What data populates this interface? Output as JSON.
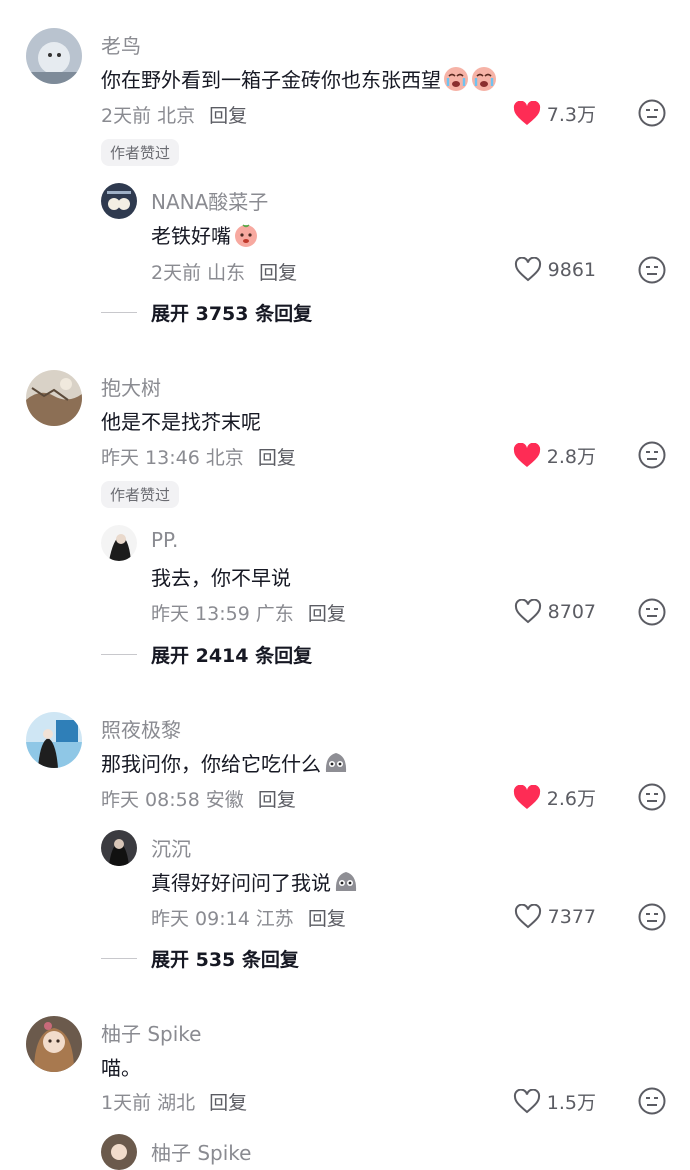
{
  "threads": [
    {
      "user": "老鸟",
      "text": "你在野外看到一箱子金砖你也东张西望",
      "emoji": [
        "crying-face",
        "crying-face"
      ],
      "time": "2天前",
      "location": "北京",
      "reply_label": "回复",
      "likes": "7.3万",
      "liked": true,
      "badge": "作者赞过",
      "reply": {
        "user": "NANA酸菜子",
        "text": "老铁好嘴",
        "emoji": [
          "peach-face"
        ],
        "time": "2天前",
        "location": "山东",
        "reply_label": "回复",
        "likes": "9861",
        "liked": false
      },
      "expand": "展开 3753 条回复"
    },
    {
      "user": "抱大树",
      "text": "他是不是找芥末呢",
      "emoji": [],
      "time": "昨天 13:46",
      "location": "北京",
      "reply_label": "回复",
      "likes": "2.8万",
      "liked": true,
      "badge": "作者赞过",
      "reply": {
        "user": "PP.",
        "text": "我去，你不早说",
        "emoji": [],
        "time": "昨天 13:59",
        "location": "广东",
        "reply_label": "回复",
        "likes": "8707",
        "liked": false
      },
      "expand": "展开 2414 条回复"
    },
    {
      "user": "照夜极黎",
      "text": "那我问你，你给它吃什么",
      "emoji": [
        "gray-blob-face"
      ],
      "time": "昨天 08:58",
      "location": "安徽",
      "reply_label": "回复",
      "likes": "2.6万",
      "liked": true,
      "badge": "",
      "reply": {
        "user": "沉沉",
        "text": "真得好好问问了我说",
        "emoji": [
          "gray-blob-face"
        ],
        "time": "昨天 09:14",
        "location": "江苏",
        "reply_label": "回复",
        "likes": "7377",
        "liked": false
      },
      "expand": "展开 535 条回复"
    },
    {
      "user": "柚子 Spike",
      "text": "喵。",
      "emoji": [],
      "time": "1天前",
      "location": "湖北",
      "reply_label": "回复",
      "likes": "1.5万",
      "liked": false,
      "badge": "",
      "reply_partial_user": "柚子 Spike"
    }
  ],
  "colors": {
    "like_active": "#fe2c55",
    "muted": "#8a8b91",
    "text": "#161823"
  }
}
